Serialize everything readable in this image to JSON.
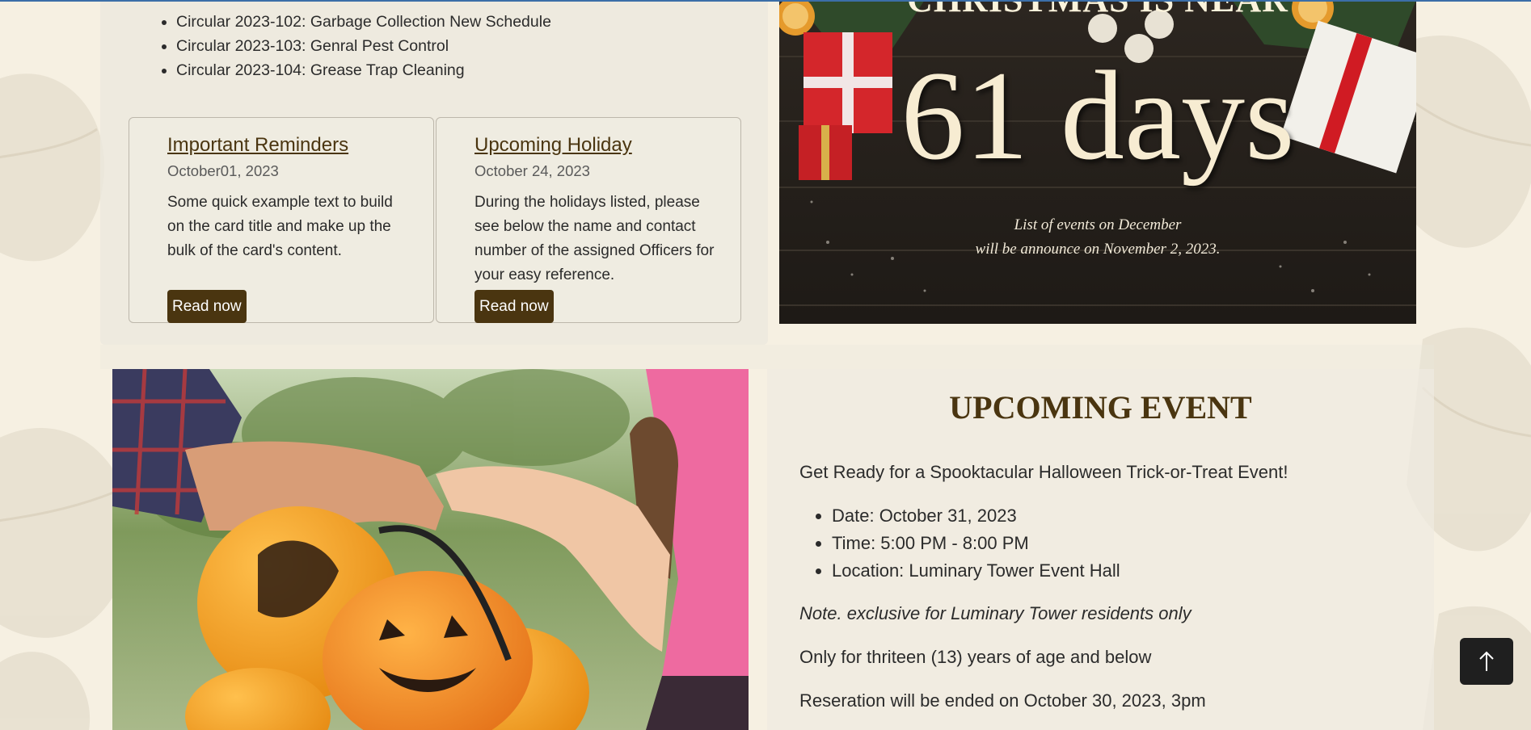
{
  "circulars": {
    "items": [
      "Circular 2023-102: Garbage Collection New Schedule",
      "Circular 2023-103: Genral Pest Control",
      "Circular 2023-104: Grease Trap Cleaning"
    ]
  },
  "cards": [
    {
      "title": "Important Reminders",
      "date": "October01, 2023",
      "text": "Some quick example text to build on the card title and make up the bulk of the card's content.",
      "button": "Read now"
    },
    {
      "title": "Upcoming Holiday",
      "date": "October 24, 2023",
      "text": "During the holidays listed, please see below the name and contact number of the assigned Officers for your easy reference.",
      "button": "Read now"
    }
  ],
  "christmas": {
    "title": "CHRISTMAS IS NEAR",
    "days": "61 days",
    "line1": "List of events on December",
    "line2": "will be announce on November 2, 2023."
  },
  "event": {
    "heading": "UPCOMING EVENT",
    "intro": "Get Ready for a Spooktacular Halloween Trick-or-Treat Event!",
    "details": [
      "Date: October 31, 2023",
      "Time: 5:00 PM - 8:00 PM",
      "Location: Luminary Tower Event Hall"
    ],
    "note": "Note. exclusive for Luminary Tower residents only",
    "age": "Only for thriteen (13) years of age and below",
    "reservation": "Reseration will be ended on October 30, 2023, 3pm"
  },
  "icons": {
    "back_to_top": "arrow-up-icon"
  },
  "colors": {
    "accent": "#4a3510",
    "background": "#f6f0e2",
    "button_dark": "#1f1f1f"
  }
}
